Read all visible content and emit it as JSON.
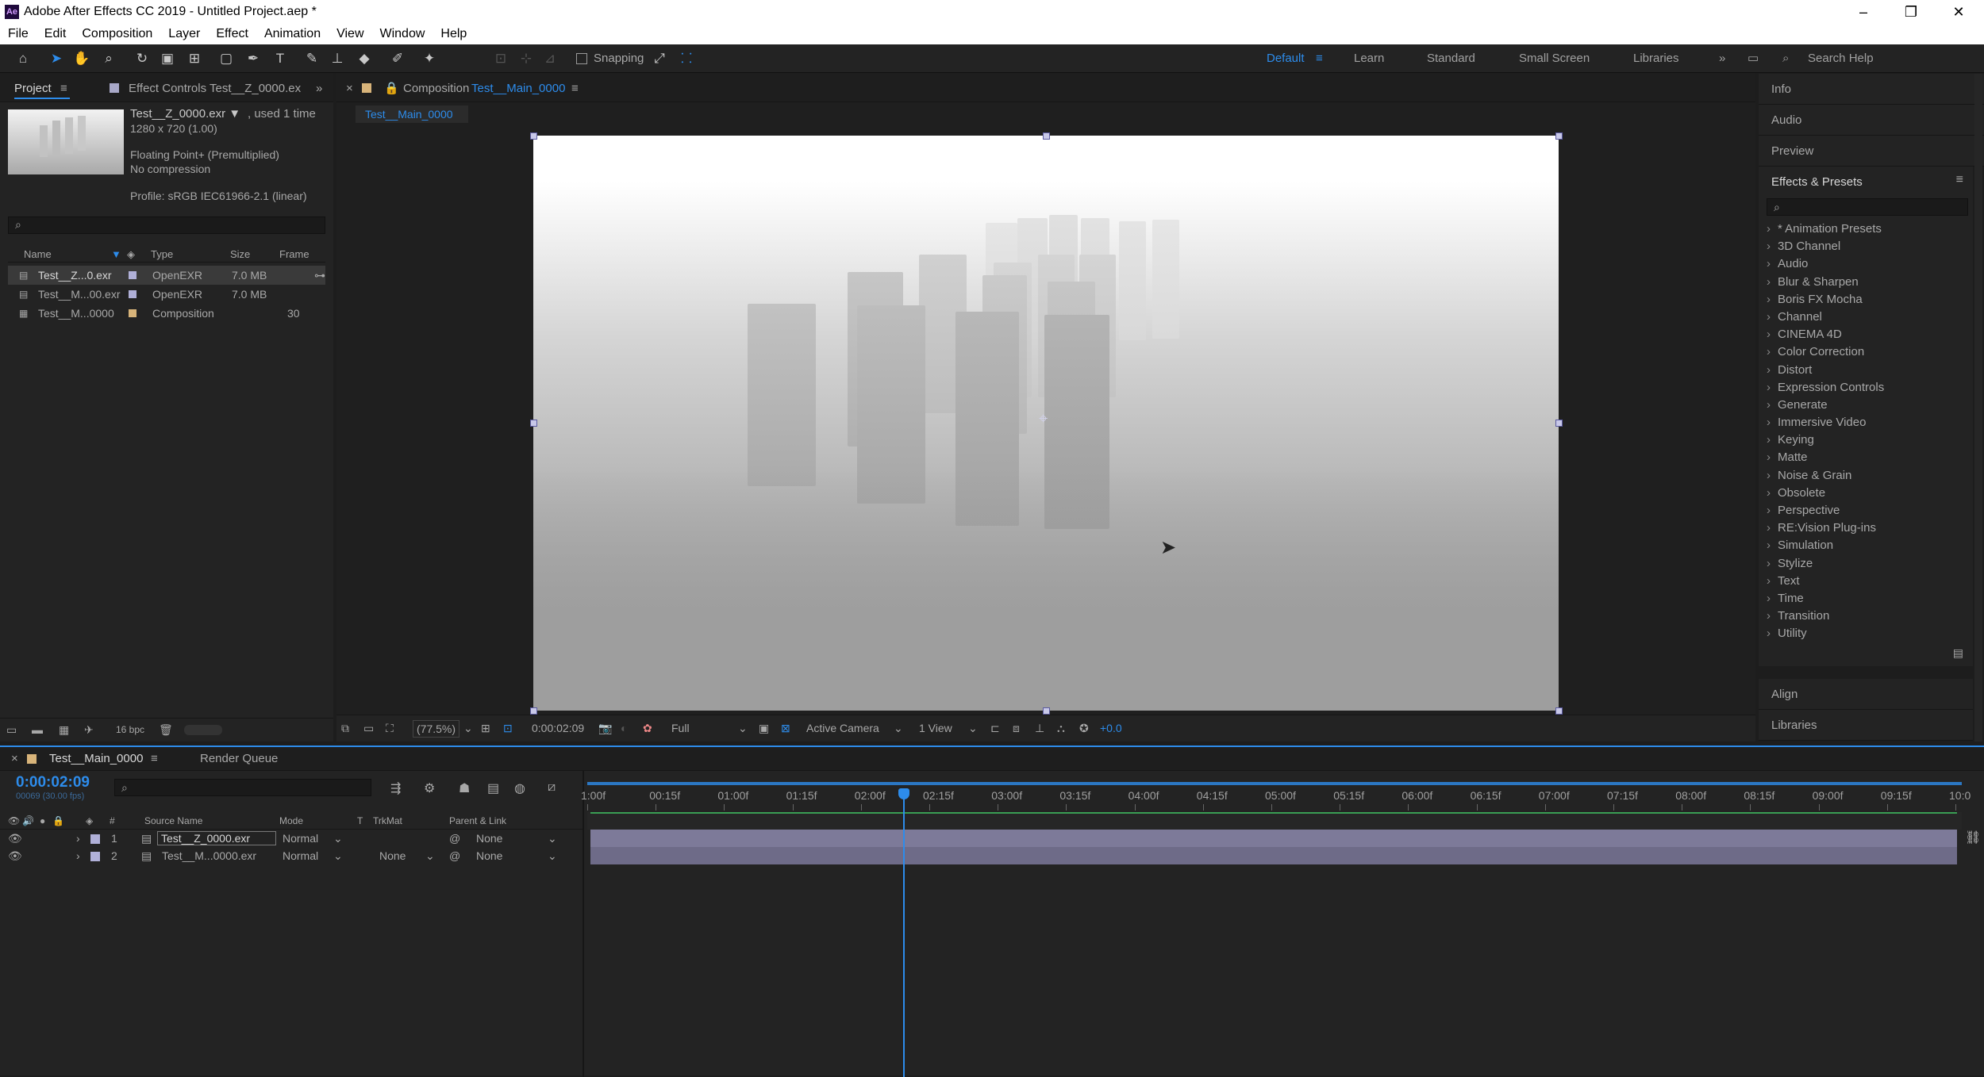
{
  "window": {
    "title": "Adobe After Effects CC 2019 - Untitled Project.aep *",
    "app_icon": "Ae",
    "minimize": "–",
    "maximize": "❐",
    "close": "✕"
  },
  "menu": [
    "File",
    "Edit",
    "Composition",
    "Layer",
    "Effect",
    "Animation",
    "View",
    "Window",
    "Help"
  ],
  "toolbar": {
    "snapping": "Snapping",
    "workspaces": [
      "Default",
      "Learn",
      "Standard",
      "Small Screen",
      "Libraries"
    ],
    "search_placeholder": "Search Help"
  },
  "project": {
    "tab": "Project",
    "effect_controls_tab": "Effect Controls Test__Z_0000.ex",
    "file_name": "Test__Z_0000.exr ▼",
    "used": ", used 1 time",
    "dims": "1280 x 720 (1.00)",
    "format": "Floating Point+ (Premultiplied)",
    "compression": "No compression",
    "profile": "Profile: sRGB IEC61966-2.1 (linear)",
    "columns": [
      "Name",
      "Type",
      "Size",
      "Frame R..."
    ],
    "items": [
      {
        "name": "Test__Z...0.exr",
        "type": "OpenEXR",
        "size": "7.0 MB",
        "fr": ""
      },
      {
        "name": "Test__M...00.exr",
        "type": "OpenEXR",
        "size": "7.0 MB",
        "fr": ""
      },
      {
        "name": "Test__M...0000",
        "type": "Composition",
        "size": "",
        "fr": "30"
      }
    ],
    "bpc": "16 bpc"
  },
  "composition": {
    "tab_prefix": "Composition",
    "tab_name": "Test__Main_0000",
    "breadcrumb": "Test__Main_0000",
    "zoom": "(77.5%)",
    "timecode": "0:00:02:09",
    "resolution": "Full",
    "camera": "Active Camera",
    "views": "1 View",
    "exposure": "+0.0"
  },
  "right": {
    "top_tabs": [
      "Info",
      "Audio",
      "Preview"
    ],
    "effects_title": "Effects & Presets",
    "effects": [
      "* Animation Presets",
      "3D Channel",
      "Audio",
      "Blur & Sharpen",
      "Boris FX Mocha",
      "Channel",
      "CINEMA 4D",
      "Color Correction",
      "Distort",
      "Expression Controls",
      "Generate",
      "Immersive Video",
      "Keying",
      "Matte",
      "Noise & Grain",
      "Obsolete",
      "Perspective",
      "RE:Vision Plug-ins",
      "Simulation",
      "Stylize",
      "Text",
      "Time",
      "Transition",
      "Utility"
    ],
    "bottom_tabs": [
      "Align",
      "Libraries"
    ]
  },
  "timeline": {
    "tab": "Test__Main_0000",
    "render_queue": "Render Queue",
    "timecode": "0:00:02:09",
    "sub_timecode": "00069 (30.00 fps)",
    "columns": {
      "num": "#",
      "source": "Source Name",
      "mode": "Mode",
      "t": "T",
      "trkmat": "TrkMat",
      "parent": "Parent & Link"
    },
    "ruler": [
      "1:00f",
      "00:15f",
      "01:00f",
      "01:15f",
      "02:00f",
      "02:15f",
      "03:00f",
      "03:15f",
      "04:00f",
      "04:15f",
      "05:00f",
      "05:15f",
      "06:00f",
      "06:15f",
      "07:00f",
      "07:15f",
      "08:00f",
      "08:15f",
      "09:00f",
      "09:15f",
      "10:0"
    ],
    "layers": [
      {
        "num": "1",
        "name": "Test__Z_0000.exr",
        "mode": "Normal",
        "trkmat": "",
        "parent": "None"
      },
      {
        "num": "2",
        "name": "Test__M...0000.exr",
        "mode": "Normal",
        "trkmat": "None",
        "parent": "None"
      }
    ],
    "playhead_fraction": 0.231
  },
  "colors": {
    "accent": "#2d8ceb",
    "bar_green": "#3a9e54",
    "layer_bar": "#7d7a99"
  }
}
